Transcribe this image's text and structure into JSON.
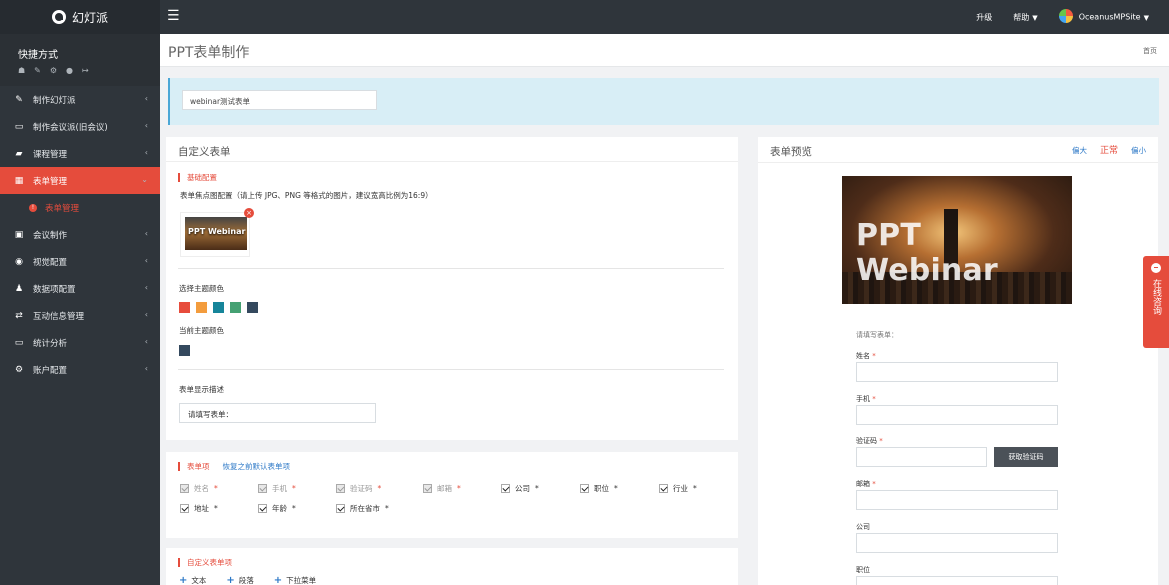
{
  "app": {
    "logo_text": "幻灯派",
    "quick_title": "快捷方式",
    "quick_icons": [
      "home-icon",
      "edit-icon",
      "gear-icon",
      "chat-icon",
      "logout-icon"
    ]
  },
  "sidebar": {
    "items": [
      {
        "label": "制作幻灯派",
        "icon": "pencil-square-icon"
      },
      {
        "label": "制作会议派(旧会议)",
        "icon": "monitor-icon"
      },
      {
        "label": "课程管理",
        "icon": "book-icon"
      },
      {
        "label": "表单管理",
        "icon": "table-icon"
      },
      {
        "label": "会议制作",
        "icon": "edit-square-icon"
      },
      {
        "label": "视觉配置",
        "icon": "eye-icon"
      },
      {
        "label": "数据项配置",
        "icon": "users-icon"
      },
      {
        "label": "互动信息管理",
        "icon": "exchange-icon"
      },
      {
        "label": "统计分析",
        "icon": "desktop-icon"
      },
      {
        "label": "账户配置",
        "icon": "cogs-icon"
      }
    ],
    "subitem": {
      "label": "表单管理",
      "icon": "info-icon"
    }
  },
  "topbar": {
    "upgrade": "升级",
    "help": "帮助",
    "user": "OceanusMPSite"
  },
  "page": {
    "title": "PPT表单制作",
    "breadcrumb": "首页",
    "form_name": "webinar测试表单"
  },
  "custom_form": {
    "title": "自定义表单",
    "basic_config": "基础配置",
    "image_hint": "表单焦点图配置（请上传 JPG、PNG 等格式的图片，建议宽高比例为16:9）",
    "thumbnail_text": "PPT Webinar",
    "theme_label": "选择主题颜色",
    "current_theme_label": "当前主题颜色",
    "display_desc_label": "表单显示描述",
    "display_desc_value": "请填写表单：",
    "theme_colors": [
      "#e74c3c",
      "#f39c3d",
      "#16859a",
      "#45a173",
      "#34495e"
    ],
    "current_color": "#34495e"
  },
  "form_items": {
    "title": "表单项",
    "restore": "恢复之前默认表单项",
    "items": [
      {
        "label": "姓名",
        "required": true,
        "disabled": true
      },
      {
        "label": "手机",
        "required": true,
        "disabled": true
      },
      {
        "label": "验证码",
        "required": true,
        "disabled": true
      },
      {
        "label": "邮箱",
        "required": true,
        "disabled": true
      },
      {
        "label": "公司",
        "required": true,
        "disabled": false
      },
      {
        "label": "职位",
        "required": true,
        "disabled": false
      },
      {
        "label": "行业",
        "required": true,
        "disabled": false
      },
      {
        "label": "地址",
        "required": true,
        "disabled": false
      },
      {
        "label": "年龄",
        "required": true,
        "disabled": false
      },
      {
        "label": "所在省市",
        "required": true,
        "disabled": false
      }
    ]
  },
  "custom_items": {
    "title": "自定义表单项",
    "add_text": "文本",
    "add_paragraph": "段落",
    "add_dropdown": "下拉菜单"
  },
  "preview": {
    "title": "表单预览",
    "size_large": "偏大",
    "size_normal": "正常",
    "size_small": "偏小",
    "banner_text": "PPT Webinar",
    "form_prompt": "请填写表单：",
    "fields": [
      "姓名",
      "手机",
      "验证码",
      "邮箱",
      "公司",
      "职位"
    ],
    "sms_button": "获取验证码"
  },
  "consult": {
    "text": "在线咨询"
  }
}
